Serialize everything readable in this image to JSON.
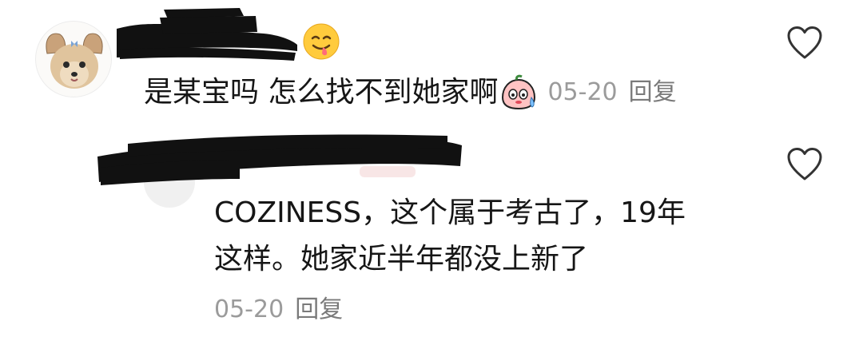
{
  "comments": [
    {
      "username": "",
      "name_emoji": "grinning-tongue-emoji",
      "text": "是某宝吗 怎么找不到她家啊",
      "text_emoji": "sweating-peach-emoji",
      "date": "05-20",
      "reply_label": "回复",
      "like_icon": "heart-outline-icon",
      "avatar_icon": "yorkie-dog-avatar"
    },
    {
      "username": "",
      "text_line1": "COZINESS，这个属于考古了，19年",
      "text_line2": "这样。她家近半年都没上新了",
      "date": "05-20",
      "reply_label": "回复",
      "like_icon": "heart-outline-icon"
    }
  ],
  "colors": {
    "text": "#161616",
    "meta": "#9b9b9b",
    "redaction": "#111111",
    "icon_stroke": "#333333"
  }
}
